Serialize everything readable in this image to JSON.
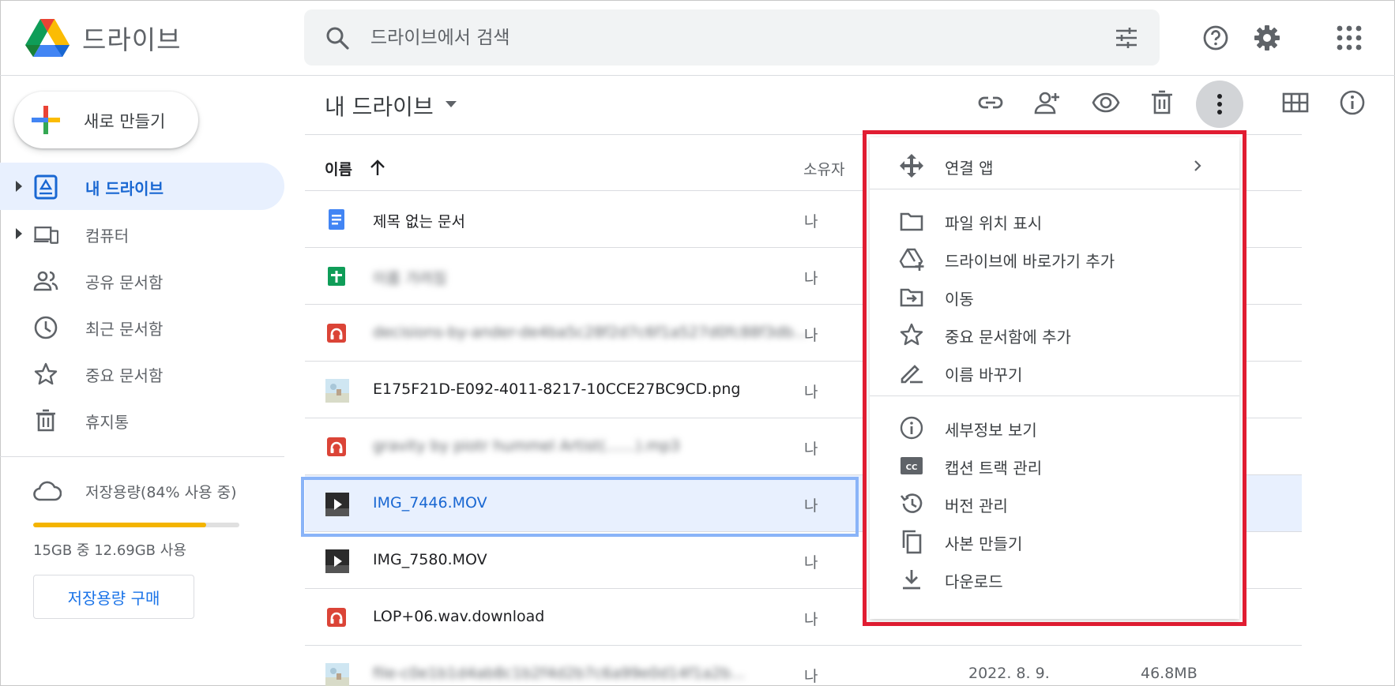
{
  "app": {
    "title": "드라이브"
  },
  "search": {
    "placeholder": "드라이브에서 검색"
  },
  "sidebar": {
    "new_button": "새로 만들기",
    "items": [
      {
        "label": "내 드라이브",
        "icon": "my-drive-icon",
        "active": true
      },
      {
        "label": "컴퓨터",
        "icon": "computers-icon",
        "active": false
      },
      {
        "label": "공유 문서함",
        "icon": "people-icon",
        "active": false
      },
      {
        "label": "최근 문서함",
        "icon": "clock-icon",
        "active": false
      },
      {
        "label": "중요 문서함",
        "icon": "star-icon",
        "active": false
      },
      {
        "label": "휴지통",
        "icon": "trash-icon",
        "active": false
      }
    ],
    "storage": {
      "label": "저장용량(84% 사용 중)",
      "used_text": "15GB 중 12.69GB 사용",
      "percent": 84,
      "buy_button": "저장용량 구매"
    }
  },
  "main": {
    "breadcrumb": "내 드라이브",
    "columns": {
      "name": "이름",
      "owner": "소유자"
    },
    "files": [
      {
        "name": "제목 없는 문서",
        "owner": "나",
        "date": "",
        "size": "",
        "type": "doc",
        "blurred": false,
        "selected": false
      },
      {
        "name": "이름 가려짐",
        "owner": "나",
        "date": "",
        "size": "",
        "type": "sheet",
        "blurred": true,
        "selected": false
      },
      {
        "name": "decisions-by-ander-de4ba5c28f2d7c6f1a527d0fc88f3db…",
        "owner": "나",
        "date": "",
        "size": "",
        "type": "audio",
        "blurred": true,
        "selected": false
      },
      {
        "name": "E175F21D-E092-4011-8217-10CCE27BC9CD.png",
        "owner": "나",
        "date": "",
        "size": "",
        "type": "image",
        "blurred": false,
        "selected": false
      },
      {
        "name": "gravity by piotr hummel Artist(……).mp3",
        "owner": "나",
        "date": "",
        "size": "",
        "type": "audio",
        "blurred": true,
        "selected": false
      },
      {
        "name": "IMG_7446.MOV",
        "owner": "나",
        "date": "",
        "size": "",
        "type": "video",
        "blurred": false,
        "selected": true
      },
      {
        "name": "IMG_7580.MOV",
        "owner": "나",
        "date": "",
        "size": "",
        "type": "video",
        "blurred": false,
        "selected": false
      },
      {
        "name": "LOP+06.wav.download",
        "owner": "나",
        "date": "",
        "size": "",
        "type": "audio",
        "blurred": false,
        "selected": false
      },
      {
        "name": "file-c0e1b1d4ab8c1b2f4d2b7c6a99e0d14f1a2b...",
        "owner": "나",
        "date": "2022. 8. 9.",
        "size": "46.8MB",
        "type": "image",
        "blurred": true,
        "selected": false
      }
    ]
  },
  "context_menu": {
    "groups": [
      [
        {
          "label": "연결 앱",
          "icon": "open-with-icon",
          "submenu": true
        }
      ],
      [
        {
          "label": "파일 위치 표시",
          "icon": "folder-icon"
        },
        {
          "label": "드라이브에 바로가기 추가",
          "icon": "add-shortcut-icon"
        },
        {
          "label": "이동",
          "icon": "move-icon"
        },
        {
          "label": "중요 문서함에 추가",
          "icon": "star-icon"
        },
        {
          "label": "이름 바꾸기",
          "icon": "rename-icon"
        }
      ],
      [
        {
          "label": "세부정보 보기",
          "icon": "info-icon"
        },
        {
          "label": "캡션 트랙 관리",
          "icon": "captions-icon"
        },
        {
          "label": "버전 관리",
          "icon": "history-icon"
        },
        {
          "label": "사본 만들기",
          "icon": "copy-icon"
        },
        {
          "label": "다운로드",
          "icon": "download-icon"
        }
      ]
    ]
  },
  "colors": {
    "accent": "#1967d2",
    "highlight": "#e11d32",
    "selection": "#e8f0fe",
    "storage": "#f4b400"
  }
}
